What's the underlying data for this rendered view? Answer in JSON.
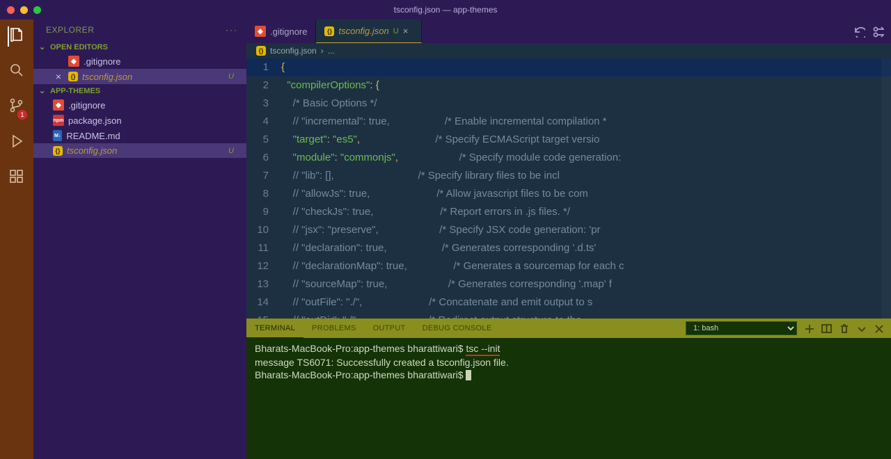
{
  "window": {
    "title": "tsconfig.json — app-themes"
  },
  "sidebar": {
    "title": "EXPLORER",
    "openEditors": {
      "label": "OPEN EDITORS"
    },
    "folder": {
      "label": "APP-THEMES"
    },
    "editors": [
      {
        "name": ".gitignore",
        "icon": "git",
        "status": ""
      },
      {
        "name": "tsconfig.json",
        "icon": "ts",
        "status": "U",
        "modified": true,
        "closable": true
      }
    ],
    "files": [
      {
        "name": ".gitignore",
        "icon": "git",
        "status": ""
      },
      {
        "name": "package.json",
        "icon": "npm",
        "status": ""
      },
      {
        "name": "README.md",
        "icon": "md",
        "status": ""
      },
      {
        "name": "tsconfig.json",
        "icon": "ts",
        "status": "U",
        "modified": true,
        "selected": true
      }
    ]
  },
  "activity": {
    "scm_badge": "1"
  },
  "tabs": [
    {
      "name": ".gitignore",
      "icon": "git",
      "active": false
    },
    {
      "name": "tsconfig.json",
      "icon": "ts",
      "status": "U",
      "active": true,
      "modified": true,
      "closable": true
    }
  ],
  "breadcrumb": {
    "file": "tsconfig.json",
    "more": "..."
  },
  "editor": {
    "lines": [
      {
        "n": 1,
        "seg": [
          [
            "p",
            "{"
          ]
        ]
      },
      {
        "n": 2,
        "seg": [
          [
            "",
            "  "
          ],
          [
            "k",
            "\"compilerOptions\""
          ],
          [
            "p",
            ": {"
          ]
        ]
      },
      {
        "n": 3,
        "seg": [
          [
            "",
            "    "
          ],
          [
            "cm",
            "/* Basic Options */"
          ]
        ]
      },
      {
        "n": 4,
        "seg": [
          [
            "",
            "    "
          ],
          [
            "cm",
            "// \"incremental\": true,                   /* Enable incremental compilation *"
          ]
        ]
      },
      {
        "n": 5,
        "seg": [
          [
            "",
            "    "
          ],
          [
            "k",
            "\"target\""
          ],
          [
            "p",
            ": "
          ],
          [
            "s",
            "\"es5\""
          ],
          [
            "p",
            ","
          ],
          [
            "",
            "                          "
          ],
          [
            "cm",
            "/* Specify ECMAScript target versio"
          ]
        ]
      },
      {
        "n": 6,
        "seg": [
          [
            "",
            "    "
          ],
          [
            "k",
            "\"module\""
          ],
          [
            "p",
            ": "
          ],
          [
            "s",
            "\"commonjs\""
          ],
          [
            "p",
            ","
          ],
          [
            "",
            "                     "
          ],
          [
            "cm",
            "/* Specify module code generation: "
          ]
        ]
      },
      {
        "n": 7,
        "seg": [
          [
            "",
            "    "
          ],
          [
            "cm",
            "// \"lib\": [],                             /* Specify library files to be incl"
          ]
        ]
      },
      {
        "n": 8,
        "seg": [
          [
            "",
            "    "
          ],
          [
            "cm",
            "// \"allowJs\": true,                       /* Allow javascript files to be com"
          ]
        ]
      },
      {
        "n": 9,
        "seg": [
          [
            "",
            "    "
          ],
          [
            "cm",
            "// \"checkJs\": true,                       /* Report errors in .js files. */"
          ]
        ]
      },
      {
        "n": 10,
        "seg": [
          [
            "",
            "    "
          ],
          [
            "cm",
            "// \"jsx\": \"preserve\",                     /* Specify JSX code generation: 'pr"
          ]
        ]
      },
      {
        "n": 11,
        "seg": [
          [
            "",
            "    "
          ],
          [
            "cm",
            "// \"declaration\": true,                   /* Generates corresponding '.d.ts' "
          ]
        ]
      },
      {
        "n": 12,
        "seg": [
          [
            "",
            "    "
          ],
          [
            "cm",
            "// \"declarationMap\": true,                /* Generates a sourcemap for each c"
          ]
        ]
      },
      {
        "n": 13,
        "seg": [
          [
            "",
            "    "
          ],
          [
            "cm",
            "// \"sourceMap\": true,                     /* Generates corresponding '.map' f"
          ]
        ]
      },
      {
        "n": 14,
        "seg": [
          [
            "",
            "    "
          ],
          [
            "cm",
            "// \"outFile\": \"./\",                       /* Concatenate and emit output to s"
          ]
        ]
      },
      {
        "n": 15,
        "seg": [
          [
            "",
            "    "
          ],
          [
            "cm",
            "// \"outDir\": \"./\",                        /* Redirect output structure to the"
          ]
        ]
      }
    ],
    "currentLine": 1
  },
  "panel": {
    "tabs": [
      "TERMINAL",
      "PROBLEMS",
      "OUTPUT",
      "DEBUG CONSOLE"
    ],
    "activeTab": 0,
    "selector": "1: bash",
    "term": {
      "line1_prefix": "Bharats-MacBook-Pro:app-themes bharattiwari$ ",
      "line1_cmd": "tsc --init",
      "line2": "message TS6071: Successfully created a tsconfig.json file.",
      "line3": "Bharats-MacBook-Pro:app-themes bharattiwari$ "
    }
  }
}
